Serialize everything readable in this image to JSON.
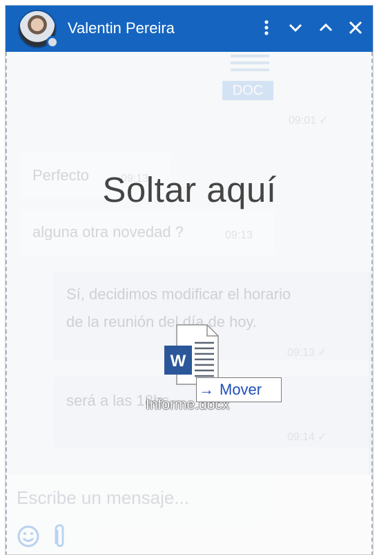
{
  "header": {
    "contact_name": "Valentin Pereira",
    "buttons": {
      "more": "more-vertical",
      "minimize": "minimize",
      "maximize": "maximize",
      "close": "close"
    }
  },
  "messages": [
    {
      "direction": "out",
      "type": "document",
      "doc_label": "DOC",
      "time": "09:01",
      "status": "read"
    },
    {
      "direction": "in",
      "text": "Perfecto",
      "time": "09:13"
    },
    {
      "direction": "in",
      "text": "alguna otra novedad ?",
      "time": "09:13"
    },
    {
      "direction": "out",
      "lines": [
        "Sí, decidimos modificar el horario",
        "de la reunión del día de hoy."
      ],
      "time": "09:13",
      "status": "read"
    },
    {
      "direction": "out",
      "text": "será a las 18hs",
      "time": "09:14",
      "status": "read"
    }
  ],
  "composer": {
    "placeholder": "Escribe un mensaje...",
    "emoji_icon": "emoji-icon",
    "attach_icon": "paperclip-icon"
  },
  "drag": {
    "drop_text": "Soltar aquí",
    "file_name": "Informe.docx",
    "file_icon": "word-document-icon",
    "action_label": "Mover",
    "action_arrow": "→"
  },
  "colors": {
    "header_bg": "#1565c0",
    "accent": "#1e4fb8",
    "panel_bg": "#f4f5f7"
  }
}
